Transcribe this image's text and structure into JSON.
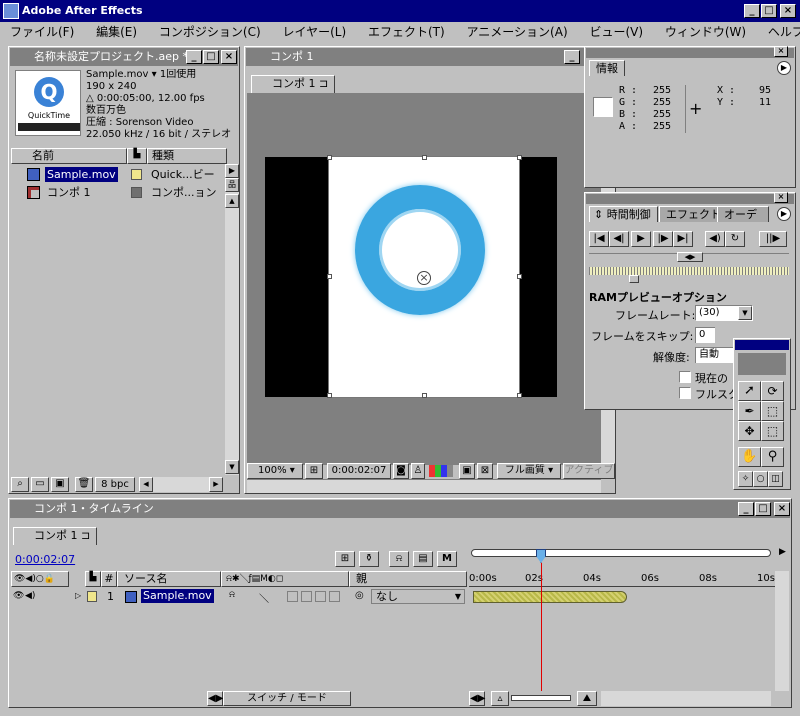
{
  "app": {
    "title": "Adobe After Effects"
  },
  "menu": [
    "ファイル(F)",
    "編集(E)",
    "コンポジション(C)",
    "レイヤー(L)",
    "エフェクト(T)",
    "アニメーション(A)",
    "ビュー(V)",
    "ウィンドウ(W)",
    "ヘルプ(H)"
  ],
  "project": {
    "title": "名称未設定プロジェクト.aep *",
    "file_name": "Sample.mov ▾ 1回使用",
    "lines": [
      "190 x 240",
      "△ 0:00:05:00, 12.00 fps",
      "数百万色",
      "圧縮 : Sorenson Video",
      "22.050 kHz / 16 bit / ステレオ"
    ],
    "thumb_label": "QuickTime",
    "col_name": "名前",
    "col_type": "種類",
    "items": [
      {
        "name": "Sample.mov",
        "type": "Quick...ビー",
        "color": "#f0e68c"
      },
      {
        "name": "コンポ 1",
        "type": "コンポ...ョン",
        "color": "#707070"
      }
    ],
    "bpc": "8 bpc"
  },
  "comp": {
    "title": "コンポ 1",
    "tab": "コンポ 1",
    "zoom": "100%",
    "timecode": "0:00:02:07",
    "quality": "フル画質",
    "view": "アクティブ"
  },
  "info": {
    "title": "情報",
    "R": "255",
    "G": "255",
    "B": "255",
    "A": "255",
    "X": "95",
    "Y": "11",
    "R_label": "R :",
    "G_label": "G :",
    "B_label": "B :",
    "A_label": "A :",
    "X_label": "X :",
    "Y_label": "Y :"
  },
  "time_control": {
    "tabs": [
      "時間制御",
      "エフェクト",
      "オーディオ"
    ],
    "ram_title": "RAMプレビューオプション",
    "frame_rate_label": "フレームレート:",
    "frame_rate": "(30)",
    "skip_label": "フレームをスキップ:",
    "skip": "0",
    "res_label": "解像度:",
    "res": "自動",
    "check1": "現在の",
    "check2": "フルスク"
  },
  "timeline": {
    "title": "コンポ 1・タイムライン",
    "tab": "コンポ 1",
    "timecode": "0:00:02:07",
    "col_source": "ソース名",
    "col_parent": "親",
    "layer_num": "1",
    "layer_name": "Sample.mov",
    "parent": "なし",
    "switches": "スイッチ / モード",
    "ruler": [
      "0:00s",
      "02s",
      "04s",
      "06s",
      "08s",
      "10s"
    ],
    "playhead_frac": 0.24
  }
}
